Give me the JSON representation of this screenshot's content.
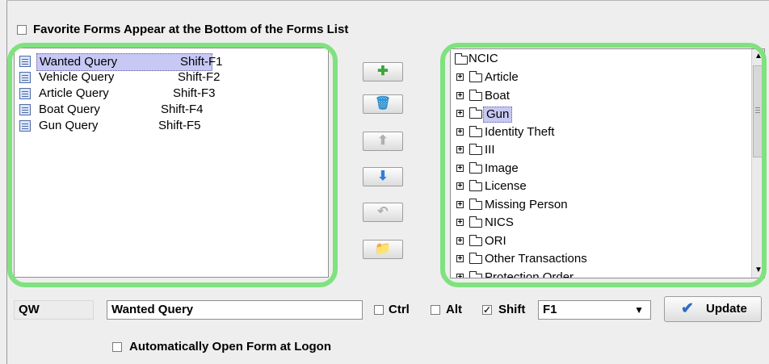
{
  "favorites_option": {
    "checked": false,
    "label": "Favorite Forms Appear at the Bottom of the Forms List"
  },
  "forms_list": [
    {
      "name": "Wanted Query",
      "shortcut": "Shift-F1",
      "selected": true,
      "icon": "form-icon"
    },
    {
      "name": "Vehicle Query",
      "shortcut": "Shift-F2",
      "selected": false,
      "icon": "form-icon"
    },
    {
      "name": "Article Query",
      "shortcut": "Shift-F3",
      "selected": false,
      "icon": "form-icon"
    },
    {
      "name": "Boat Query",
      "shortcut": "Shift-F4",
      "selected": false,
      "icon": "form-icon"
    },
    {
      "name": "Gun Query",
      "shortcut": "Shift-F5",
      "selected": false,
      "icon": "form-icon"
    }
  ],
  "toolbar": [
    {
      "action": "add",
      "icon": "plus-icon",
      "enabled": true,
      "color": "#3aa53a"
    },
    {
      "action": "delete",
      "icon": "recycle-bin-icon",
      "enabled": true,
      "color": "#2d8fd0"
    },
    {
      "action": "move-up",
      "icon": "up-arrow-icon",
      "enabled": false,
      "color": "#b0b0b0"
    },
    {
      "action": "move-down",
      "icon": "down-arrow-icon",
      "enabled": true,
      "color": "#2f7fd9"
    },
    {
      "action": "undo",
      "icon": "undo-icon",
      "enabled": false,
      "color": "#b0b0b0"
    },
    {
      "action": "add-folder",
      "icon": "folder-add-icon",
      "enabled": true,
      "color": "#e0b030"
    }
  ],
  "tree": {
    "root": "NCIC",
    "items": [
      {
        "label": "Article",
        "selected": false
      },
      {
        "label": "Boat",
        "selected": false
      },
      {
        "label": "Gun",
        "selected": true
      },
      {
        "label": "Identity Theft",
        "selected": false
      },
      {
        "label": "III",
        "selected": false
      },
      {
        "label": "Image",
        "selected": false
      },
      {
        "label": "License",
        "selected": false
      },
      {
        "label": "Missing Person",
        "selected": false
      },
      {
        "label": "NICS",
        "selected": false
      },
      {
        "label": "ORI",
        "selected": false
      },
      {
        "label": "Other Transactions",
        "selected": false
      },
      {
        "label": "Protection Order",
        "selected": false
      }
    ]
  },
  "form_edit": {
    "code": "QW",
    "name": "Wanted Query",
    "ctrl_label": "Ctrl",
    "ctrl_checked": false,
    "alt_label": "Alt",
    "alt_checked": false,
    "shift_label": "Shift",
    "shift_checked": true,
    "key_value": "F1",
    "update_label": "Update"
  },
  "auto_open": {
    "checked": false,
    "label": "Automatically Open Form at Logon"
  },
  "colors": {
    "highlight": "#7fe27f",
    "selection": "#c8c8f5"
  }
}
